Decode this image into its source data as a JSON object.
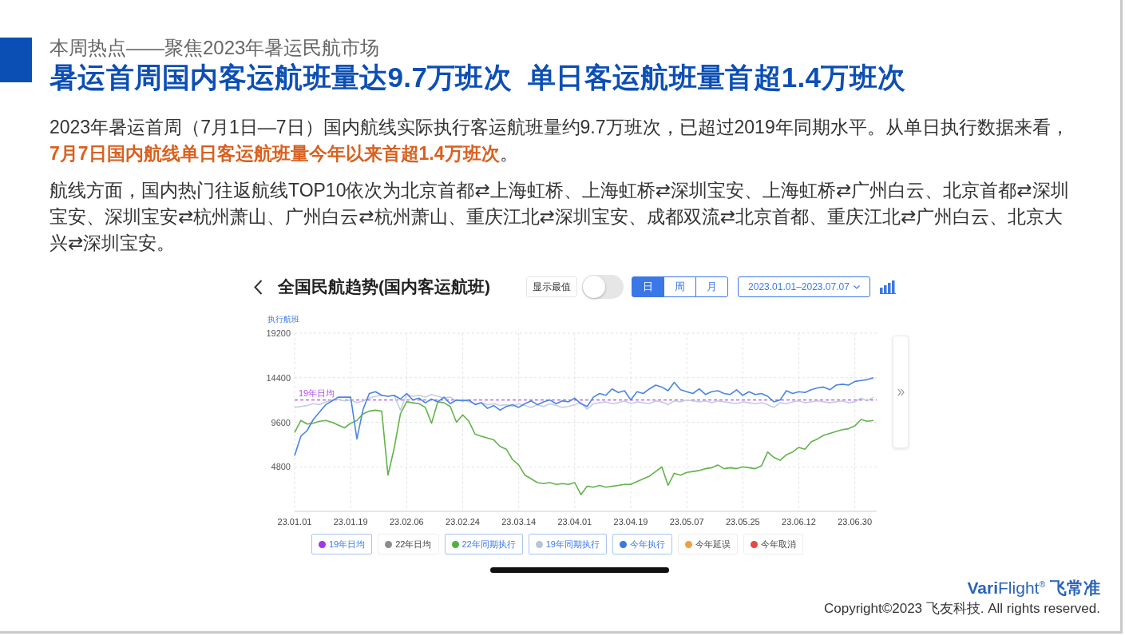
{
  "heading": {
    "kicker": "本周热点——聚焦2023年暑运民航市场",
    "title": "暑运首周国内客运航班量达9.7万班次  单日客运航班量首超1.4万班次"
  },
  "paragraphs": [
    "2023年暑运首周（7月1日—7日）国内航线实际执行客运航班量约9.7万班次，已超过2019年同期水平。从单日执行数据来看，**7月7日国内航线单日客运航班量今年以来首超1.4万班次**。",
    "航线方面，国内热门往返航线TOP10依次为北京首都⇄上海虹桥、上海虹桥⇄深圳宝安、上海虹桥⇄广州白云、北京首都⇄深圳宝安、深圳宝安⇄杭州萧山、广州白云⇄杭州萧山、重庆江北⇄深圳宝安、成都双流⇄北京首都、重庆江北⇄广州白云、北京大兴⇄深圳宝安。"
  ],
  "trend_panel": {
    "title": "全国民航趋势(国内客运航班)",
    "show_extremes": {
      "label": "显示最值",
      "on": false
    },
    "periods": [
      {
        "label": "日",
        "selected": true
      },
      {
        "label": "周",
        "selected": false
      },
      {
        "label": "月",
        "selected": false
      }
    ],
    "date_range": "2023.01.01–2023.07.07",
    "chart_data": {
      "type": "line",
      "ylabel": "执行航班",
      "ylim": [
        0,
        19200
      ],
      "yticks": [
        4800,
        9600,
        14400,
        19200
      ],
      "grid": true,
      "categories": [
        "23.01.01",
        null,
        null,
        null,
        null,
        null,
        null,
        null,
        null,
        "23.01.19",
        null,
        null,
        null,
        null,
        null,
        null,
        null,
        null,
        "23.02.06",
        null,
        null,
        null,
        null,
        null,
        null,
        null,
        null,
        "23.02.24",
        null,
        null,
        null,
        null,
        null,
        null,
        null,
        null,
        "23.03.14",
        null,
        null,
        null,
        null,
        null,
        null,
        null,
        null,
        "23.04.01",
        null,
        null,
        null,
        null,
        null,
        null,
        null,
        null,
        "23.04.19",
        null,
        null,
        null,
        null,
        null,
        null,
        null,
        null,
        "23.05.07",
        null,
        null,
        null,
        null,
        null,
        null,
        null,
        null,
        "23.05.25",
        null,
        null,
        null,
        null,
        null,
        null,
        null,
        null,
        "23.06.12",
        null,
        null,
        null,
        null,
        null,
        null,
        null,
        null,
        "23.06.30",
        null,
        null,
        null
      ],
      "series": [
        {
          "color": "#c3cde3",
          "values": [
            11200,
            11300,
            11400,
            11600,
            11500,
            11800,
            12000,
            12100,
            11900,
            12000,
            11700,
            11900,
            12200,
            12400,
            12500,
            12400,
            12500,
            10900,
            12600,
            12400,
            12500,
            12300,
            12600,
            12400,
            12200,
            12300,
            11900,
            12100,
            11800,
            11600,
            11700,
            11500,
            11600,
            11400,
            11500,
            11300,
            11600,
            11400,
            11200,
            11500,
            11300,
            11600,
            11400,
            11200,
            11300,
            11500,
            11700,
            11000,
            11600,
            11700,
            11800,
            11600,
            11700,
            11900,
            11600,
            11800,
            11700,
            11600,
            11900,
            11800,
            11500,
            11900,
            11800,
            12000,
            11900,
            11800,
            11900,
            11700,
            11900,
            11800,
            11700,
            11600,
            11800,
            11700,
            11600,
            11700,
            11500,
            11200,
            11700,
            11600,
            11800,
            11900,
            11700,
            11800,
            11900,
            11800,
            11700,
            11800,
            11900,
            11700,
            11800,
            12200,
            11900,
            12300
          ]
        },
        {
          "color": "#62b34a",
          "values": [
            8500,
            9800,
            9400,
            9500,
            9700,
            9800,
            9600,
            9300,
            9000,
            9500,
            9800,
            10500,
            10800,
            10900,
            10800,
            3900,
            6800,
            10500,
            11800,
            11700,
            11600,
            11200,
            9500,
            11800,
            11700,
            11300,
            9600,
            10400,
            9700,
            8300,
            8100,
            7900,
            7700,
            7000,
            6700,
            5600,
            5000,
            3900,
            3500,
            3100,
            3000,
            3100,
            2900,
            3000,
            2900,
            3100,
            1800,
            2700,
            2600,
            2800,
            2600,
            2700,
            2800,
            2900,
            2900,
            3200,
            3500,
            3800,
            4300,
            4800,
            2800,
            4100,
            3900,
            4200,
            4300,
            4400,
            4600,
            4700,
            5000,
            4600,
            4700,
            4600,
            4800,
            4700,
            4600,
            4900,
            6400,
            5800,
            5500,
            6100,
            6400,
            6900,
            6700,
            7500,
            7800,
            8200,
            8400,
            8600,
            8800,
            8900,
            9200,
            9900,
            9700,
            9800
          ]
        },
        {
          "color": "#4a84e4",
          "values": [
            6000,
            8100,
            8700,
            9900,
            10700,
            11500,
            11900,
            12300,
            12300,
            12300,
            7800,
            11000,
            12700,
            12900,
            12500,
            12400,
            12500,
            12100,
            12700,
            12000,
            12200,
            11700,
            12100,
            11800,
            12300,
            11600,
            12000,
            11900,
            12000,
            11500,
            11700,
            11100,
            11400,
            10900,
            11300,
            11500,
            11200,
            11600,
            11900,
            11500,
            11800,
            12000,
            11600,
            11900,
            11800,
            12200,
            11600,
            11300,
            12300,
            12700,
            12500,
            13200,
            12800,
            13000,
            12000,
            12900,
            12700,
            13200,
            13600,
            13400,
            13000,
            13900,
            13100,
            12900,
            12700,
            13200,
            12600,
            12900,
            13000,
            12700,
            12600,
            13100,
            12500,
            12900,
            12600,
            12700,
            12400,
            11800,
            12000,
            13000,
            12700,
            12900,
            12800,
            13100,
            13300,
            13400,
            13100,
            13600,
            13700,
            13600,
            14000,
            14100,
            14200,
            14400
          ]
        }
      ],
      "ref_lines": [
        {
          "axis": "y",
          "value": 12000,
          "label": "19年日均",
          "color": "#b04ee8"
        }
      ]
    },
    "legend": [
      {
        "label": "19年日均",
        "color": "#a335ee",
        "selected": true
      },
      {
        "label": "22年日均",
        "color": "#8c8c8c",
        "selected": false
      },
      {
        "label": "22年同期执行",
        "color": "#52b043",
        "selected": true
      },
      {
        "label": "19年同期执行",
        "color": "#b8c4da",
        "selected": true
      },
      {
        "label": "今年执行",
        "color": "#3b78e7",
        "selected": true
      },
      {
        "label": "今年延误",
        "color": "#f0a040",
        "selected": false
      },
      {
        "label": "今年取消",
        "color": "#e8473f",
        "selected": false
      }
    ]
  },
  "footer": {
    "logo": "**Vari**Flight$^{®}$ **飞常准**",
    "copyright": "Copyright©2023 飞友科技. All rights reserved."
  }
}
